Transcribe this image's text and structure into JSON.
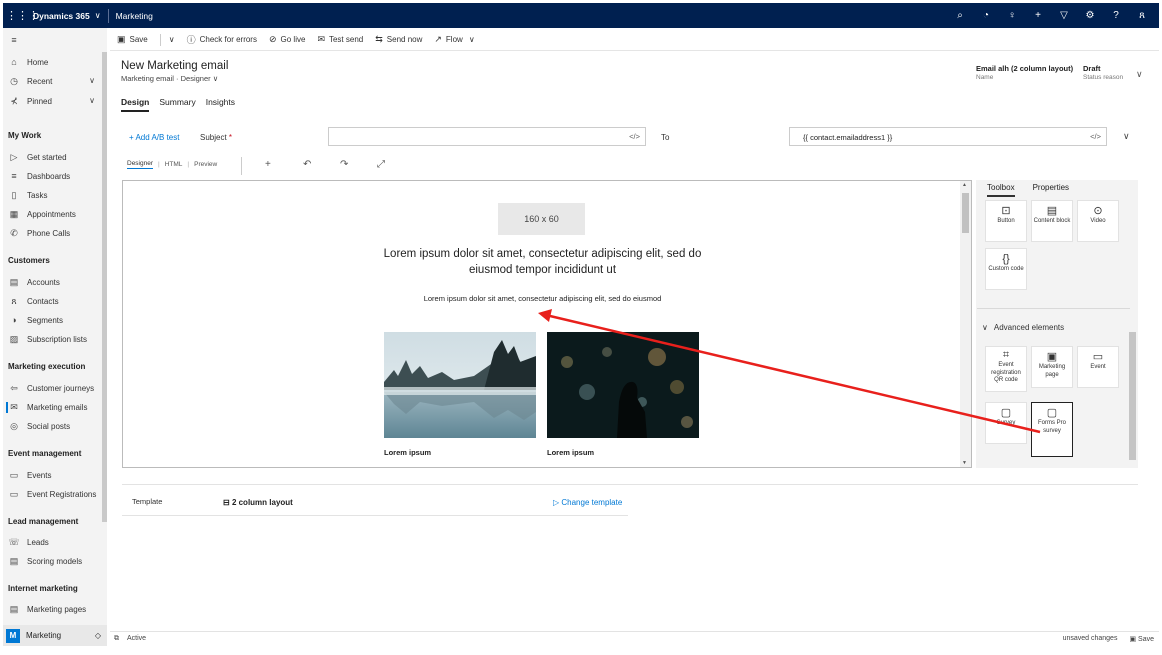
{
  "topbar": {
    "app_name": "Dynamics 365",
    "module": "Marketing"
  },
  "sidebar": {
    "home": "Home",
    "recent": "Recent",
    "pinned": "Pinned",
    "sections": {
      "my_work": "My Work",
      "customers": "Customers",
      "marketing_execution": "Marketing execution",
      "event_management": "Event management",
      "lead_management": "Lead management",
      "internet_marketing": "Internet marketing"
    },
    "items": {
      "get_started": "Get started",
      "dashboards": "Dashboards",
      "tasks": "Tasks",
      "appointments": "Appointments",
      "phone_calls": "Phone Calls",
      "accounts": "Accounts",
      "contacts": "Contacts",
      "segments": "Segments",
      "subscription_lists": "Subscription lists",
      "customer_journeys": "Customer journeys",
      "marketing_emails": "Marketing emails",
      "social_posts": "Social posts",
      "events": "Events",
      "event_registrations": "Event Registrations",
      "leads": "Leads",
      "scoring_models": "Scoring models",
      "marketing_pages": "Marketing pages"
    },
    "footer": {
      "badge": "M",
      "label": "Marketing"
    }
  },
  "commands": {
    "save": "Save",
    "check_errors": "Check for errors",
    "go_live": "Go live",
    "test_send": "Test send",
    "send_now": "Send now",
    "flow": "Flow"
  },
  "header": {
    "title": "New Marketing email",
    "entity": "Marketing email",
    "form": "Designer",
    "name_value": "Email alh (2 column layout)",
    "name_label": "Name",
    "status_value": "Draft",
    "status_label": "Status reason"
  },
  "tabs": [
    "Design",
    "Summary",
    "Insights"
  ],
  "fields": {
    "ab_test": "Add A/B test",
    "subject_label": "Subject",
    "subject_required": "*",
    "subject_value": "",
    "to_label": "To",
    "to_value": "{{ contact.emailaddress1 }}",
    "code_glyph": "</>"
  },
  "designer_tabs": [
    "Designer",
    "HTML",
    "Preview"
  ],
  "canvas": {
    "placeholder": "160 x 60",
    "heading": "Lorem ipsum dolor sit amet, consectetur adipiscing elit, sed do eiusmod tempor incididunt ut",
    "paragraph": "Lorem ipsum dolor sit amet, consectetur adipiscing elit, sed do eiusmod",
    "caption_left": "Lorem ipsum",
    "caption_right": "Lorem ipsum"
  },
  "toolbox": {
    "tabs": [
      "Toolbox",
      "Properties"
    ],
    "tiles": {
      "button": "Button",
      "content_block": "Content block",
      "video": "Video",
      "custom_code": "Custom code",
      "event_qr": "Event registration QR code",
      "marketing_page": "Marketing page",
      "event": "Event",
      "survey": "Survey",
      "forms_pro": "Forms Pro survey"
    },
    "advanced": "Advanced elements"
  },
  "template": {
    "label": "Template",
    "value": "2 column layout",
    "change": "Change template"
  },
  "statusbar": {
    "status": "Active",
    "unsaved": "unsaved changes",
    "save": "Save"
  },
  "colors": {
    "nav": "#002050",
    "accent": "#0078d4",
    "arrow": "#e8201c"
  }
}
